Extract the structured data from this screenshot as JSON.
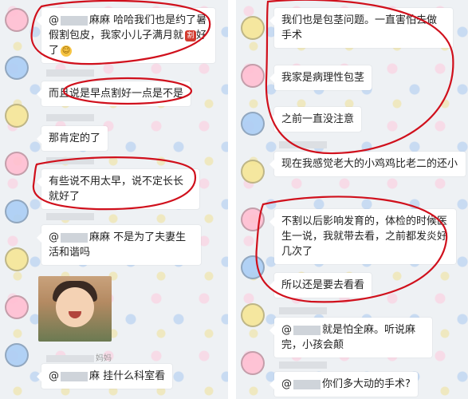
{
  "left_chat": {
    "msg1": {
      "prefix": "@",
      "text": "麻麻 哈哈我们也是约了暑假割包皮，我家小儿子满月就",
      "after_emoji": "好了"
    },
    "msg2": {
      "text": "而且说是早点割好一点是不是"
    },
    "msg3": {
      "text": "那肯定的了"
    },
    "msg4": {
      "text": "有些说不用太早，说不定长长就好了"
    },
    "msg5": {
      "prefix": "@",
      "text": "麻麻 不是为了夫妻生活和谐吗"
    },
    "name_below_photo": "妈妈",
    "msg6": {
      "prefix": "@",
      "text": "麻 挂什么科室看"
    }
  },
  "right_chat": {
    "msg1": {
      "text": "我们也是包茎问题。一直害怕去做手术"
    },
    "msg2": {
      "text": "我家是病理性包茎"
    },
    "msg3": {
      "text": "之前一直没注意"
    },
    "msg4": {
      "text": "现在我感觉老大的小鸡鸡比老二的还小"
    },
    "msg5": {
      "text": "不割以后影响发育的，体检的时候医生一说，我就带去看，之前都发炎好几次了"
    },
    "msg6": {
      "text": "所以还是要去看看"
    },
    "msg7": {
      "prefix": "@",
      "text": "就是怕全麻。听说麻完，小孩会颠"
    },
    "msg8": {
      "prefix": "@",
      "text": "你们多大动的手术?"
    }
  },
  "icons": {
    "left_sticker_strip": "cartoon-sticker-background",
    "photo": "baby-photo-sticker",
    "red_emoji": "scissors-emoji",
    "smile_emoji": "smile-emoji"
  },
  "colors": {
    "background": "#eef1f4",
    "bubble": "#ffffff",
    "annotation": "#d0101c"
  }
}
